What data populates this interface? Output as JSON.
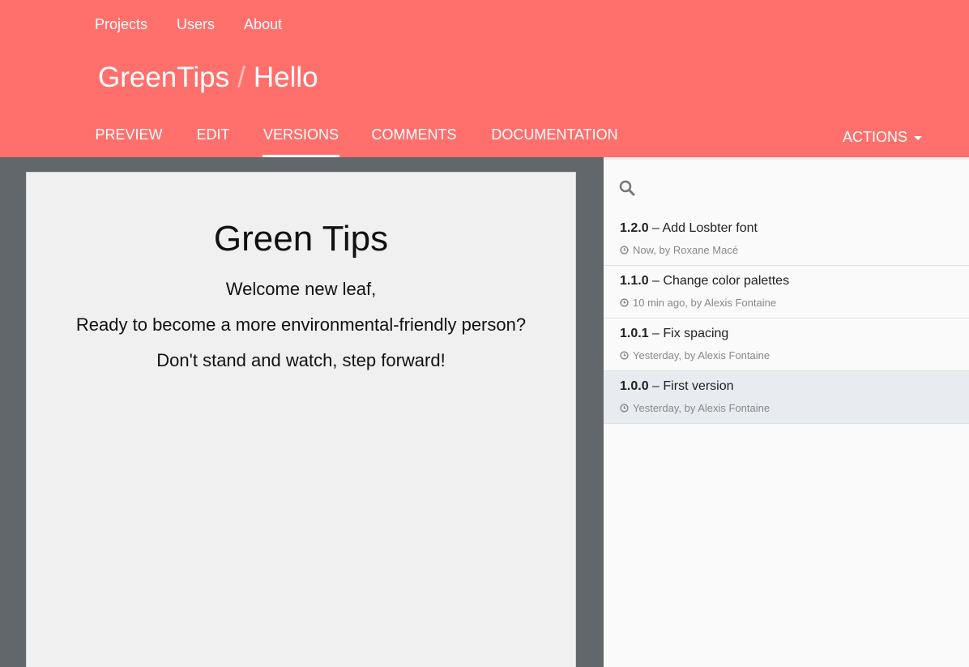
{
  "topnav": {
    "items": [
      "Projects",
      "Users",
      "About"
    ]
  },
  "breadcrumb": {
    "project": "GreenTips",
    "separator": "/",
    "page": "Hello"
  },
  "tabs": {
    "items": [
      "PREVIEW",
      "EDIT",
      "VERSIONS",
      "COMMENTS",
      "DOCUMENTATION"
    ],
    "active": "VERSIONS",
    "actions_label": "ACTIONS"
  },
  "document": {
    "title": "Green Tips",
    "lines": [
      "Welcome new leaf,",
      "Ready to become a more environmental-friendly person?",
      "Don't stand and watch, step forward!"
    ]
  },
  "versions": {
    "items": [
      {
        "number": "1.2.0",
        "dash": "–",
        "message": "Add Losbter font",
        "meta": "Now, by Roxane Macé"
      },
      {
        "number": "1.1.0",
        "dash": "–",
        "message": "Change color palettes",
        "meta": "10 min ago, by Alexis Fontaine"
      },
      {
        "number": "1.0.1",
        "dash": "–",
        "message": "Fix spacing",
        "meta": "Yesterday, by Alexis Fontaine"
      },
      {
        "number": "1.0.0",
        "dash": "–",
        "message": "First version",
        "meta": "Yesterday, by Alexis Fontaine"
      }
    ],
    "selected_index": 3
  },
  "colors": {
    "header_bg": "#ff706d",
    "background": "#62676b",
    "document_bg": "#f0f0f0",
    "panel_bg": "#fafafa",
    "selected_row_bg": "#e8ecf0"
  }
}
